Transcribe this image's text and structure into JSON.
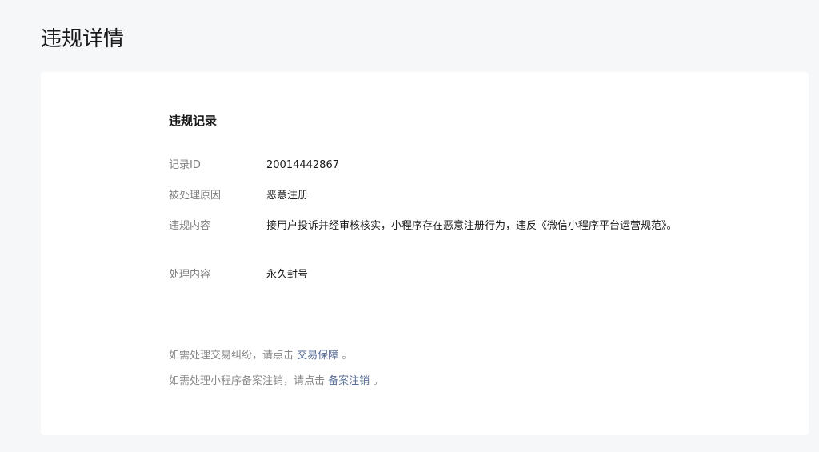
{
  "page": {
    "title": "违规详情"
  },
  "record": {
    "section_title": "违规记录",
    "rows": [
      {
        "label": "记录ID",
        "value": "20014442867"
      },
      {
        "label": "被处理原因",
        "value": "恶意注册"
      },
      {
        "label": "违规内容",
        "value": "接用户投诉并经审核核实，小程序存在恶意注册行为，违反《微信小程序平台运营规范》。"
      },
      {
        "label": "处理内容",
        "value": "永久封号"
      }
    ]
  },
  "tips": [
    {
      "prefix": "如需处理交易纠纷，请点击",
      "link": "交易保障",
      "suffix": "。"
    },
    {
      "prefix": "如需处理小程序备案注销，请点击",
      "link": "备案注销",
      "suffix": "。"
    }
  ],
  "colors": {
    "background": "#f6f7f9",
    "card": "#ffffff",
    "link": "#576b95",
    "label": "#808080",
    "text": "#1a1a1a"
  }
}
